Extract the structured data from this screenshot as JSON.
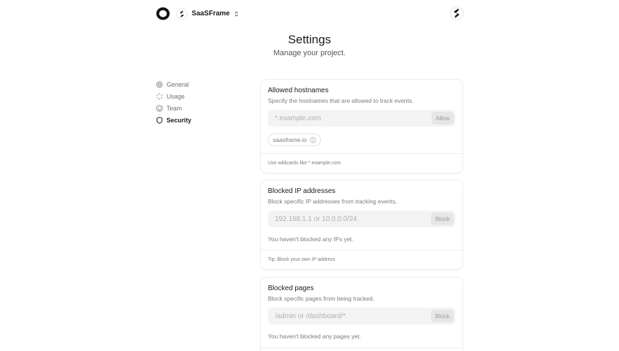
{
  "header": {
    "project_name": "SaaSFrame"
  },
  "page": {
    "title": "Settings",
    "subtitle": "Manage your project."
  },
  "sidebar": {
    "items": [
      {
        "label": "General",
        "icon": "gear-icon",
        "active": false
      },
      {
        "label": "Usage",
        "icon": "usage-icon",
        "active": false
      },
      {
        "label": "Team",
        "icon": "team-icon",
        "active": false
      },
      {
        "label": "Security",
        "icon": "shield-icon",
        "active": true
      }
    ]
  },
  "cards": {
    "allowed_hostnames": {
      "title": "Allowed hostnames",
      "description": "Specify the hostnames that are allowed to track events.",
      "input_placeholder": "*.example.com",
      "button_label": "Allow",
      "hostnames": [
        "saasframe.io"
      ],
      "footer": "Use wildcards like *.example.com"
    },
    "blocked_ips": {
      "title": "Blocked IP addresses",
      "description": "Block specific IP addresses from tracking events.",
      "input_placeholder": "192.168.1.1 or 10.0.0.0/24",
      "button_label": "Block",
      "empty_text": "You haven't blocked any IPs yet.",
      "footer": "Tip: Block your own IP address"
    },
    "blocked_pages": {
      "title": "Blocked pages",
      "description": "Block specific pages from being tracked.",
      "input_placeholder": "/admin or /dashboard/*",
      "button_label": "Block",
      "empty_text": "You haven't blocked any pages yet."
    }
  },
  "colors": {
    "background": "#ffffff",
    "text_primary": "#1a1a1a",
    "text_muted": "#7a7a7a",
    "input_bg": "#f3f3f3",
    "button_bg": "#e6e6e6",
    "border": "#ececec"
  }
}
